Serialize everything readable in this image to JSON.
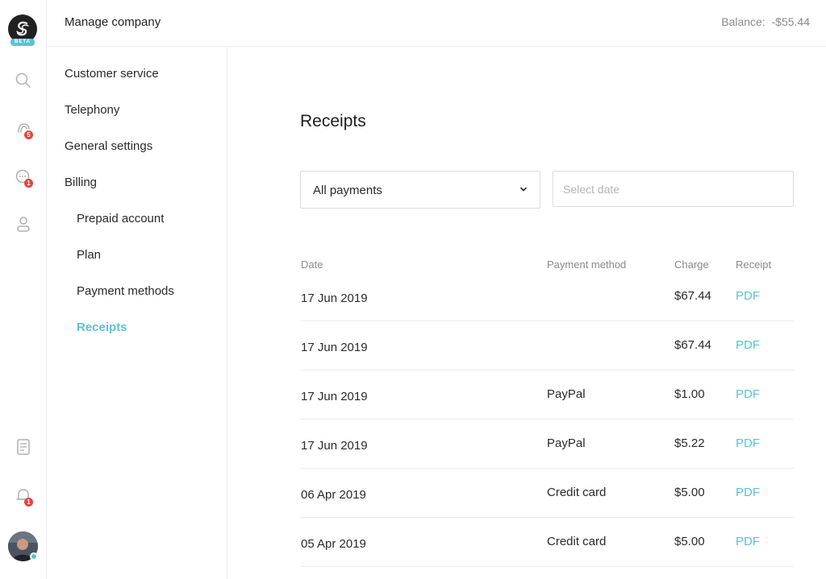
{
  "rail": {
    "logo_badge": "BETA",
    "calls_badge": "5",
    "chat_badge": "1",
    "notifications_badge": "1"
  },
  "header": {
    "title": "Manage company",
    "balance_label": "Balance:",
    "balance_value": "-$55.44"
  },
  "nav": {
    "customer_service": "Customer service",
    "telephony": "Telephony",
    "general_settings": "General settings",
    "billing": "Billing",
    "prepaid_account": "Prepaid account",
    "plan": "Plan",
    "payment_methods": "Payment methods",
    "receipts": "Receipts"
  },
  "main": {
    "title": "Receipts",
    "filter_value": "All payments",
    "date_placeholder": "Select date"
  },
  "table": {
    "headers": {
      "date": "Date",
      "method": "Payment method",
      "charge": "Charge",
      "receipt": "Receipt"
    },
    "rows": [
      {
        "date": "17 Jun 2019",
        "method": "",
        "charge": "$67.44",
        "receipt": "PDF"
      },
      {
        "date": "17 Jun 2019",
        "method": "",
        "charge": "$67.44",
        "receipt": "PDF"
      },
      {
        "date": "17 Jun 2019",
        "method": "PayPal",
        "charge": "$1.00",
        "receipt": "PDF"
      },
      {
        "date": "17 Jun 2019",
        "method": "PayPal",
        "charge": "$5.22",
        "receipt": "PDF"
      },
      {
        "date": "06 Apr 2019",
        "method": "Credit card",
        "charge": "$5.00",
        "receipt": "PDF"
      },
      {
        "date": "05 Apr 2019",
        "method": "Credit card",
        "charge": "$5.00",
        "receipt": "PDF"
      }
    ]
  },
  "colors": {
    "accent": "#5bc3d3",
    "badge": "#e8423c"
  }
}
